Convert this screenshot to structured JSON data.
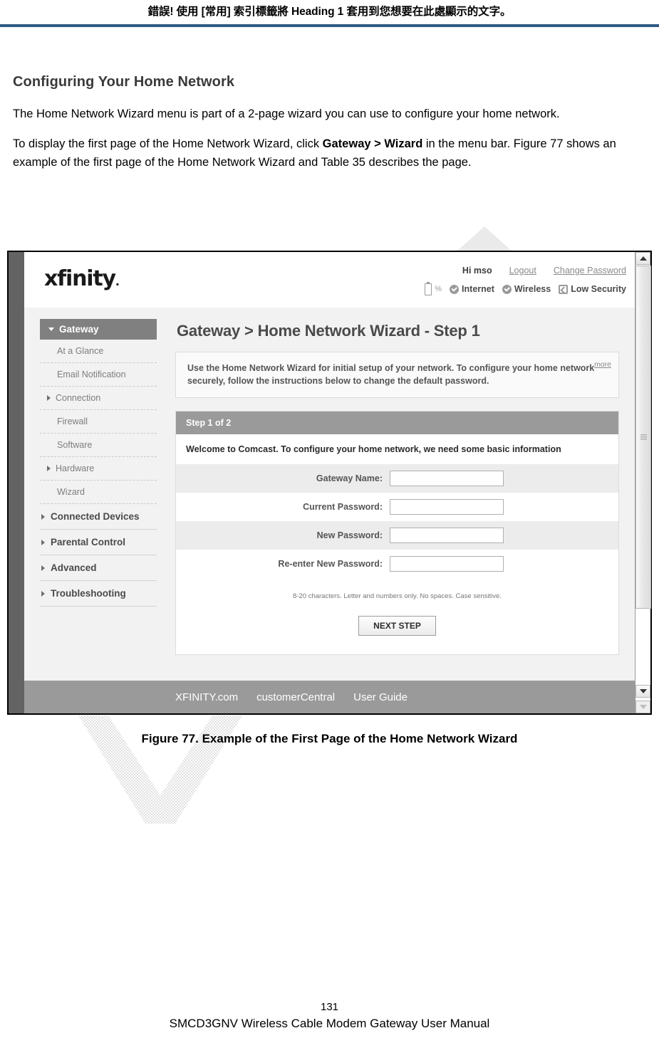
{
  "doc": {
    "running_header": "錯誤! 使用 [常用] 索引標籤將 Heading 1 套用到您想要在此處顯示的文字。",
    "section_title": "Configuring Your Home Network",
    "para1": "The Home Network Wizard menu is part of a 2-page wizard you can use to configure your home network.",
    "para2_a": "To display the first page of the Home Network Wizard, click ",
    "para2_bold": "Gateway > Wizard",
    "para2_b": " in the menu bar. Figure 77 shows an example of the first page of the Home Network Wizard and Table 35 describes the page.",
    "figure_caption": "Figure 77. Example of the First Page of the Home Network Wizard",
    "page_number": "131",
    "manual_title": "SMCD3GNV Wireless Cable Modem Gateway User Manual"
  },
  "screenshot": {
    "brand": {
      "logo": "xfinity",
      "logo_dot": "."
    },
    "account": {
      "greeting": "Hi mso",
      "logout": "Logout",
      "change_password": "Change Password",
      "battery_pct": "%",
      "status": [
        {
          "label": "Internet",
          "icon": "check-circle-icon"
        },
        {
          "label": "Wireless",
          "icon": "check-circle-icon"
        },
        {
          "label": "Low Security",
          "icon": "shield-icon"
        }
      ]
    },
    "sidebar": {
      "active": "Gateway",
      "sub_items": [
        {
          "label": "At a Glance",
          "expandable": false
        },
        {
          "label": "Email Notification",
          "expandable": false
        },
        {
          "label": "Connection",
          "expandable": true
        },
        {
          "label": "Firewall",
          "expandable": false
        },
        {
          "label": "Software",
          "expandable": false
        },
        {
          "label": "Hardware",
          "expandable": true
        },
        {
          "label": "Wizard",
          "expandable": false
        }
      ],
      "main_items": [
        {
          "label": "Connected Devices"
        },
        {
          "label": "Parental Control"
        },
        {
          "label": "Advanced"
        },
        {
          "label": "Troubleshooting"
        }
      ]
    },
    "main": {
      "page_title": "Gateway > Home Network Wizard - Step 1",
      "info_text": "Use the Home Network Wizard for initial setup of your network. To configure your home network securely, follow the instructions below to change the default password.",
      "more_label": "more",
      "step_bar": "Step 1 of 2",
      "welcome": "Welcome to Comcast. To configure your home network, we need some basic information",
      "fields": [
        {
          "label": "Gateway Name:",
          "value": "",
          "shaded": true
        },
        {
          "label": "Current Password:",
          "value": "",
          "shaded": false
        },
        {
          "label": "New Password:",
          "value": "",
          "shaded": true
        },
        {
          "label": "Re-enter New Password:",
          "value": "",
          "shaded": false
        }
      ],
      "hint": "8-20 characters. Letter and numbers only. No spaces. Case sensitive.",
      "next_button": "NEXT STEP"
    },
    "footer_links": [
      "XFINITY.com",
      "customerCentral",
      "User Guide"
    ]
  },
  "colors": {
    "header_rule": "#2e5a84",
    "nav_active": "#808080",
    "step_bar": "#9a9a9a",
    "app_footer": "#9a9a9a",
    "window_gutter": "#636363"
  }
}
